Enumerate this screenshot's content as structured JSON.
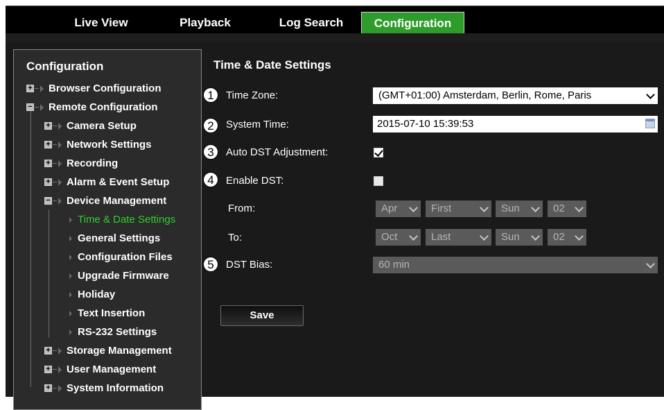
{
  "topnav": {
    "tabs": [
      {
        "label": "Live View"
      },
      {
        "label": "Playback"
      },
      {
        "label": "Log Search"
      },
      {
        "label": "Configuration"
      }
    ]
  },
  "sidebar": {
    "title": "Configuration",
    "items": [
      {
        "label": "Browser Configuration"
      },
      {
        "label": "Remote Configuration"
      },
      {
        "label": "Camera Setup"
      },
      {
        "label": "Network Settings"
      },
      {
        "label": "Recording"
      },
      {
        "label": "Alarm & Event Setup"
      },
      {
        "label": "Device Management"
      },
      {
        "label": "Time & Date Settings"
      },
      {
        "label": "General Settings"
      },
      {
        "label": "Configuration Files"
      },
      {
        "label": "Upgrade Firmware"
      },
      {
        "label": "Holiday"
      },
      {
        "label": "Text Insertion"
      },
      {
        "label": "RS-232 Settings"
      },
      {
        "label": "Storage Management"
      },
      {
        "label": "User Management"
      },
      {
        "label": "System Information"
      }
    ]
  },
  "content": {
    "title": "Time & Date Settings",
    "callouts": [
      "1",
      "2",
      "3",
      "4",
      "5"
    ],
    "time_zone_label": "Time Zone:",
    "time_zone_value": "(GMT+01:00) Amsterdam, Berlin, Rome, Paris",
    "system_time_label": "System Time:",
    "system_time_value": "2015-07-10 15:39:53",
    "auto_dst_label": "Auto DST Adjustment:",
    "auto_dst_checked": true,
    "enable_dst_label": "Enable DST:",
    "enable_dst_checked": false,
    "from_label": "From:",
    "from_month": "Apr",
    "from_week": "First",
    "from_day": "Sun",
    "from_hour": "02",
    "to_label": "To:",
    "to_month": "Oct",
    "to_week": "Last",
    "to_day": "Sun",
    "to_hour": "02",
    "dst_bias_label": "DST Bias:",
    "dst_bias_value": "60 min",
    "save_label": "Save"
  },
  "colors": {
    "accent": "#2e9c2a",
    "selected_text": "#2fcf2f",
    "panel_bg": "#1a1a1a"
  }
}
